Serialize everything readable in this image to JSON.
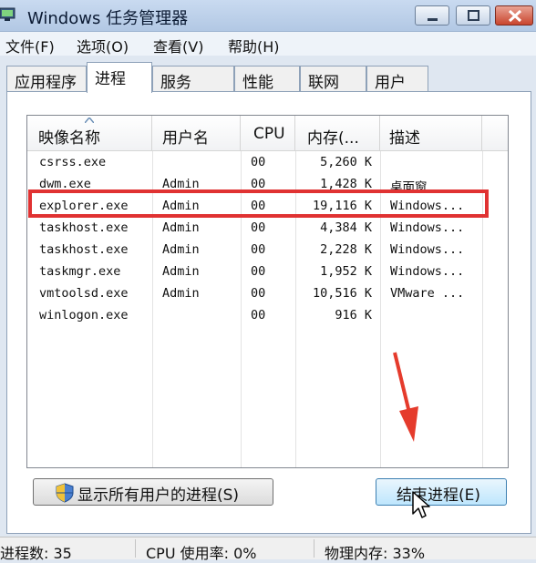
{
  "window": {
    "title": "Windows 任务管理器"
  },
  "menu": [
    "文件(F)",
    "选项(O)",
    "查看(V)",
    "帮助(H)"
  ],
  "tabs": [
    "应用程序",
    "进程",
    "服务",
    "性能",
    "联网",
    "用户"
  ],
  "active_tab": "进程",
  "columns": [
    "映像名称",
    "用户名",
    "CPU",
    "内存(...",
    "描述"
  ],
  "processes": [
    {
      "name": "csrss.exe",
      "user": "",
      "cpu": "00",
      "mem": "5,260 K",
      "desc": ""
    },
    {
      "name": "dwm.exe",
      "user": "Admin",
      "cpu": "00",
      "mem": "1,428 K",
      "desc": "桌面窗..."
    },
    {
      "name": "explorer.exe",
      "user": "Admin",
      "cpu": "00",
      "mem": "19,116 K",
      "desc": "Windows..."
    },
    {
      "name": "taskhost.exe",
      "user": "Admin",
      "cpu": "00",
      "mem": "4,384 K",
      "desc": "Windows..."
    },
    {
      "name": "taskhost.exe",
      "user": "Admin",
      "cpu": "00",
      "mem": "2,228 K",
      "desc": "Windows..."
    },
    {
      "name": "taskmgr.exe",
      "user": "Admin",
      "cpu": "00",
      "mem": "1,952 K",
      "desc": "Windows..."
    },
    {
      "name": "vmtoolsd.exe",
      "user": "Admin",
      "cpu": "00",
      "mem": "10,516 K",
      "desc": "VMware ..."
    },
    {
      "name": "winlogon.exe",
      "user": "",
      "cpu": "00",
      "mem": "916 K",
      "desc": ""
    }
  ],
  "highlighted_process": "explorer.exe",
  "buttons": {
    "show_all": "显示所有用户的进程(S)",
    "end_process": "结束进程(E)"
  },
  "status": {
    "processes": "进程数: 35",
    "cpu": "CPU 使用率: 0%",
    "memory": "物理内存: 33%"
  },
  "colors": {
    "highlight_box": "#e03232",
    "title_bar": "#b2c8e4"
  },
  "icons": [
    "monitor-icon",
    "minimize-icon",
    "maximize-icon",
    "close-icon",
    "shield-icon",
    "sort-arrow-icon",
    "mouse-cursor-icon",
    "red-arrow-annotation"
  ]
}
